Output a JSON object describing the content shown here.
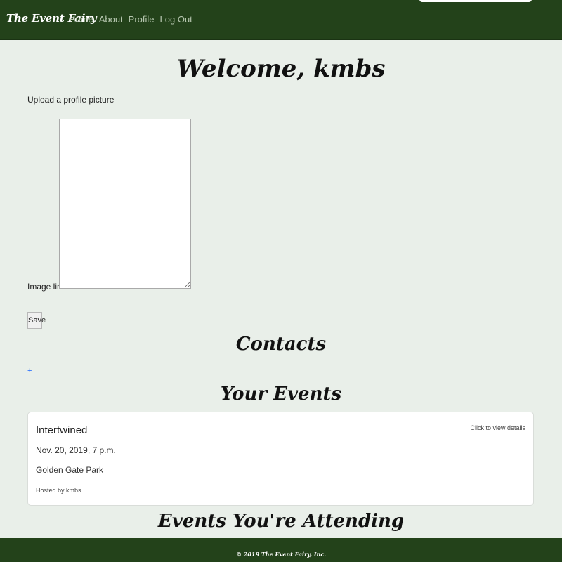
{
  "nav": {
    "brand": "The Event Fairy",
    "links": [
      "Home",
      "About",
      "Profile",
      "Log Out"
    ]
  },
  "profile": {
    "welcome": "Welcome, kmbs",
    "upload_label": "Upload a profile picture",
    "image_link_label": "Image link:",
    "image_link_value": "",
    "save_label": "Save"
  },
  "contacts": {
    "heading": "Contacts",
    "add_label": "+"
  },
  "your_events": {
    "heading": "Your Events",
    "items": [
      {
        "name": "Intertwined",
        "date": "Nov. 20, 2019, 7 p.m.",
        "location": "Golden Gate Park",
        "host": "Hosted by kmbs",
        "hint": "Click to view details"
      }
    ]
  },
  "attending": {
    "heading": "Events You're Attending"
  },
  "footer": {
    "copyright": "© 2019 The Event Fairy, Inc."
  },
  "colors": {
    "nav_bg": "#23421a",
    "page_bg": "#e9efe9",
    "link_blue": "#1a66ff"
  }
}
